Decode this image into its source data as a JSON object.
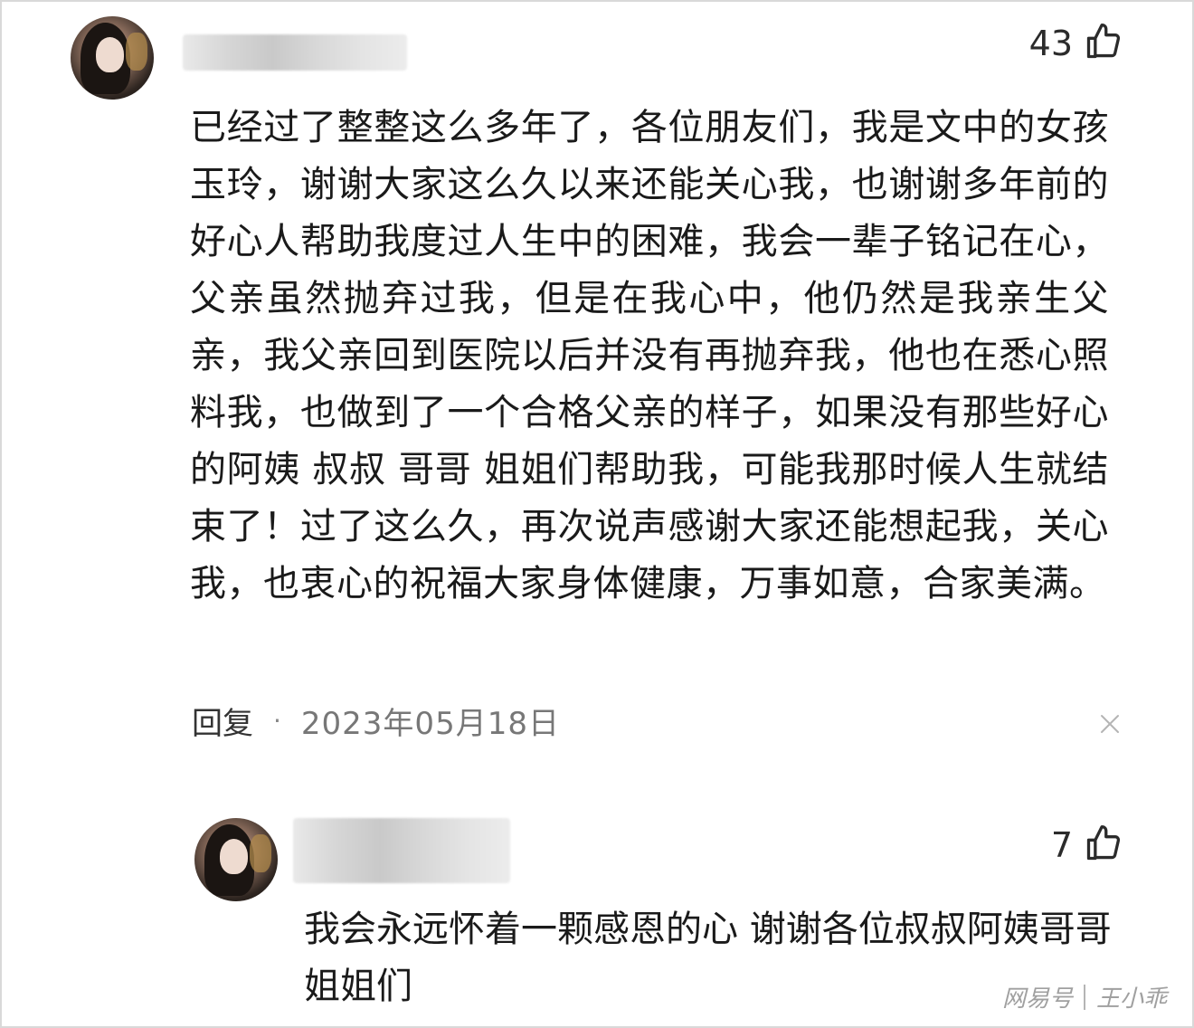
{
  "main_comment": {
    "like_count": "43",
    "text": "已经过了整整这么多年了，各位朋友们，我是文中的女孩玉玲，谢谢大家这么久以来还能关心我，也谢谢多年前的好心人帮助我度过人生中的困难，我会一辈子铭记在心，父亲虽然抛弃过我，但是在我心中，他仍然是我亲生父亲，我父亲回到医院以后并没有再抛弃我，他也在悉心照料我，也做到了一个合格父亲的样子，如果没有那些好心的阿姨 叔叔 哥哥 姐姐们帮助我，可能我那时候人生就结束了！过了这么久，再次说声感谢大家还能想起我，关心我，也衷心的祝福大家身体健康，万事如意，合家美满。",
    "reply_label": "回复",
    "separator": "·",
    "date": "2023年05月18日"
  },
  "reply_comment": {
    "like_count": "7",
    "text": "我会永远怀着一颗感恩的心 谢谢各位叔叔阿姨哥哥姐姐们"
  },
  "watermark": {
    "source": "网易号",
    "author": "王小乖"
  },
  "icons": {
    "like": "thumbs-up-icon",
    "close": "close-icon"
  },
  "colors": {
    "text": "#1a1a1a",
    "meta": "#777777",
    "watermark": "#a0a0a0"
  }
}
